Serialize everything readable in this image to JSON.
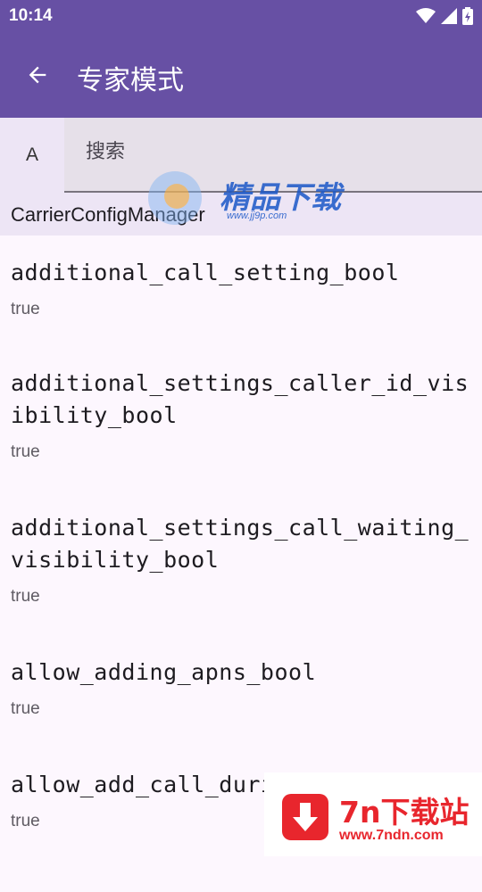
{
  "status_bar": {
    "time": "10:14",
    "icons": [
      "wifi-icon",
      "cellular-signal-icon",
      "battery-charging-icon"
    ]
  },
  "app_bar": {
    "title": "专家模式",
    "back_icon": "arrow-back-icon"
  },
  "filter": {
    "letter": "A",
    "search_placeholder": "搜索"
  },
  "section": {
    "title": "CarrierConfigManager"
  },
  "items": [
    {
      "key": "additional_call_setting_bool",
      "value": "true"
    },
    {
      "key": "additional_settings_caller_id_visibility_bool",
      "value": "true"
    },
    {
      "key": "additional_settings_call_waiting_visibility_bool",
      "value": "true"
    },
    {
      "key": "allow_adding_apns_bool",
      "value": "true"
    },
    {
      "key": "allow_add_call_during_video_call",
      "value": "true"
    }
  ],
  "watermark": {
    "text": "精品下载",
    "sub": "www.jj9p.com"
  },
  "badge": {
    "title": "7n下载站",
    "url": "www.7ndn.com"
  },
  "colors": {
    "primary": "#6750a4",
    "surface": "#fdf7fe",
    "chip_bg": "#ede5f5",
    "search_bg": "#e6e0e9",
    "badge_red": "#e8262d",
    "watermark_blue": "#1a57c8"
  }
}
